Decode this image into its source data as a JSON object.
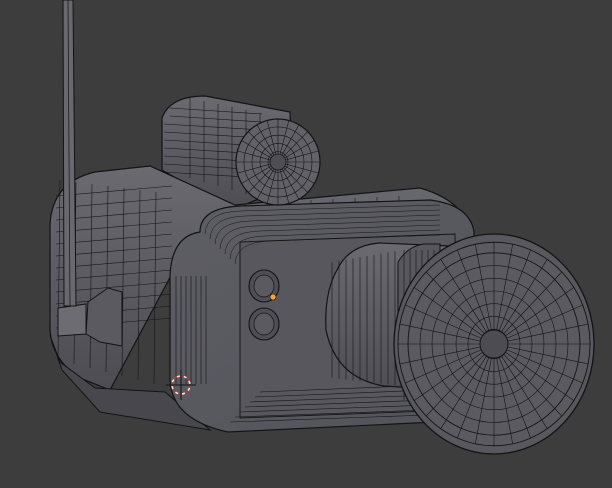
{
  "viewport": {
    "background": "#3d3d3d",
    "mode": "edit-mode-wireframe"
  },
  "colors": {
    "face_dark": "#4a4a4f",
    "face_mid": "#5d5d63",
    "face_light": "#6e6e74",
    "face_top": "#7a7a80",
    "wire": "#141416",
    "selected_vertex": "#f2a33a",
    "cursor_red": "#c8302c",
    "cursor_white": "#e8e8e8"
  },
  "icons": {
    "cursor": "3d-cursor-icon",
    "vertex": "selected-vertex-icon"
  }
}
